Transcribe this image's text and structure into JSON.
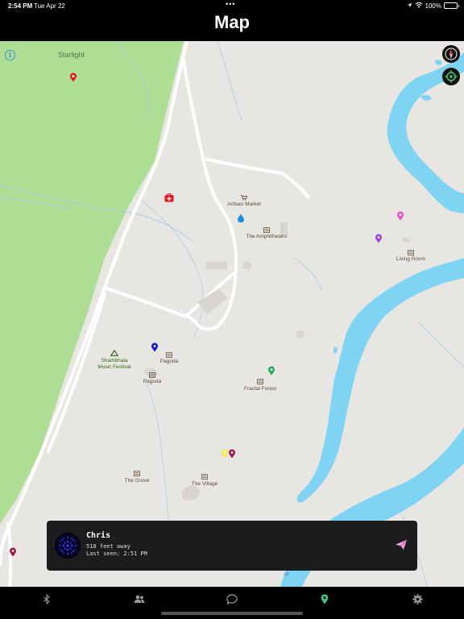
{
  "status": {
    "time": "2:54 PM",
    "date": "Tue Apr 22",
    "battery": "100%"
  },
  "header": {
    "title": "Map"
  },
  "map": {
    "area_label": "Starlight",
    "places": [
      {
        "key": "artisan",
        "name": "Artisan Market"
      },
      {
        "key": "amphi",
        "name": "The Amphitheatre"
      },
      {
        "key": "living",
        "name": "Living Room"
      },
      {
        "key": "shambhala",
        "name": "Shambhala\nMusic Festival"
      },
      {
        "key": "pagoda1",
        "name": "Pagoda"
      },
      {
        "key": "pagoda2",
        "name": "Pagoda"
      },
      {
        "key": "fractal",
        "name": "Fractal Forest"
      },
      {
        "key": "grove",
        "name": "The Grove"
      },
      {
        "key": "village",
        "name": "The Village"
      }
    ],
    "pin_colors": {
      "red": "#e5191c",
      "pink": "#f04bc8",
      "purple": "#9c3fe0",
      "blue": "#1010d8",
      "green": "#23a857",
      "yellow": "#f2e84a",
      "maroon": "#a3124a"
    }
  },
  "friend_card": {
    "name": "Chris",
    "distance": "518 feet away",
    "last_seen": "Last seen: 2:51 PM"
  },
  "tabs": [
    {
      "name": "bluetooth-icon",
      "active": false
    },
    {
      "name": "people-icon",
      "active": false
    },
    {
      "name": "chat-bubble-icon",
      "active": false
    },
    {
      "name": "map-pin-icon",
      "active": true
    },
    {
      "name": "gear-icon",
      "active": false
    }
  ],
  "colors": {
    "accent": "#3ec77a",
    "water": "#7fd4f3",
    "park": "#aedd94",
    "land": "#e8e6e2"
  }
}
